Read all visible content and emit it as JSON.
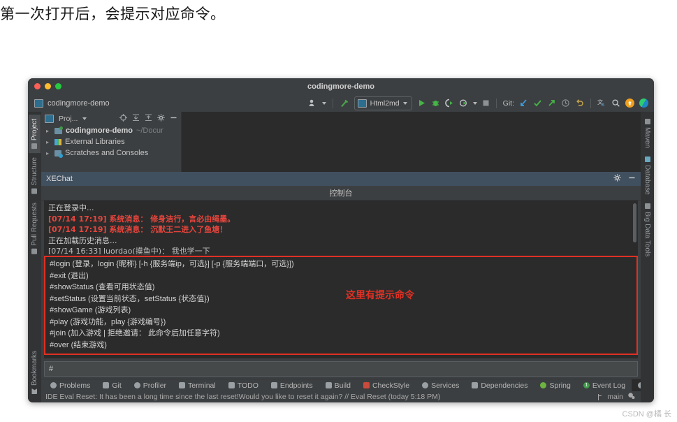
{
  "page": {
    "heading": "第一次打开后，会提示对应命令。",
    "watermark": "CSDN @橘 长"
  },
  "window": {
    "title": "codingmore-demo",
    "project_chip": "codingmore-demo"
  },
  "toolbar": {
    "run_config": "Html2md",
    "git_label": "Git:",
    "icons": [
      "profile-icon",
      "hammer-icon",
      "run-icon",
      "debug-icon",
      "coverage-icon",
      "profiler-run-icon",
      "stop-icon",
      "git-update-icon",
      "git-commit-icon",
      "git-push-icon",
      "history-icon",
      "rollback-icon",
      "translate-icon",
      "search-icon",
      "update-badge-icon",
      "plugin-logo-icon"
    ]
  },
  "left_strip": {
    "items": [
      {
        "label": "Project",
        "active": true
      },
      {
        "label": "Structure",
        "active": false
      },
      {
        "label": "Pull Requests",
        "active": false
      },
      {
        "label": "Bookmarks",
        "active": false
      }
    ]
  },
  "right_strip": {
    "items": [
      {
        "label": "Maven"
      },
      {
        "label": "Database"
      },
      {
        "label": "Big Data Tools"
      }
    ]
  },
  "project_panel": {
    "title": "Proj...",
    "tree": [
      {
        "label": "codingmore-demo",
        "suffix": "~/Docur",
        "bold": true,
        "icon": "module-folder-icon"
      },
      {
        "label": "External Libraries",
        "suffix": "",
        "bold": false,
        "icon": "libraries-icon"
      },
      {
        "label": "Scratches and Consoles",
        "suffix": "",
        "bold": false,
        "icon": "scratches-icon"
      }
    ]
  },
  "xechat": {
    "tab_label": "XEChat",
    "console_title": "控制台",
    "log": [
      {
        "text": "正在登录中...",
        "type": "normal"
      },
      {
        "text": "[07/14 17:19] 系统消息： 修身洁行，言必由绳墨。",
        "type": "system"
      },
      {
        "text": "[07/14 17:19] 系统消息： 沉默王二进入了鱼塘！",
        "type": "system"
      },
      {
        "text": "正在加载历史消息...",
        "type": "normal"
      },
      {
        "text": "[07/14 16:33] luordao(摸鱼中)： 我也学一下",
        "type": "clipped"
      }
    ],
    "commands": [
      "#login (登录，login {昵称} [-h {服务端ip，可选}] [-p {服务端端口，可选}])",
      "#exit (退出)",
      "#showStatus (查看可用状态值)",
      "#setStatus (设置当前状态，setStatus {状态值})",
      "#showGame (游戏列表)",
      "#play (游戏功能，play {游戏编号})",
      "#join (加入游戏 | 拒绝邀请： 此命令后加任意字符)",
      "#over (结束游戏)"
    ],
    "annotation": "这里有提示命令",
    "input_value": "#",
    "highlight_color": "#e03024"
  },
  "tool_windows": [
    {
      "label": "Problems",
      "icon": "problems-icon",
      "active": false,
      "badge": ""
    },
    {
      "label": "Git",
      "icon": "git-icon",
      "active": false,
      "badge": ""
    },
    {
      "label": "Profiler",
      "icon": "profiler-icon",
      "active": false,
      "badge": ""
    },
    {
      "label": "Terminal",
      "icon": "terminal-icon",
      "active": false,
      "badge": ""
    },
    {
      "label": "TODO",
      "icon": "todo-icon",
      "active": false,
      "badge": ""
    },
    {
      "label": "Endpoints",
      "icon": "endpoints-icon",
      "active": false,
      "badge": ""
    },
    {
      "label": "Build",
      "icon": "build-icon",
      "active": false,
      "badge": ""
    },
    {
      "label": "CheckStyle",
      "icon": "checkstyle-icon",
      "active": false,
      "badge": ""
    },
    {
      "label": "Services",
      "icon": "services-icon",
      "active": false,
      "badge": ""
    },
    {
      "label": "Dependencies",
      "icon": "dependencies-icon",
      "active": false,
      "badge": ""
    },
    {
      "label": "Spring",
      "icon": "spring-icon",
      "active": false,
      "badge": ""
    },
    {
      "label": "Event Log",
      "icon": "event-log-icon",
      "active": false,
      "badge": "1"
    },
    {
      "label": "XEChat",
      "icon": "xechat-icon",
      "active": true,
      "badge": ""
    }
  ],
  "statusbar": {
    "message": "IDE Eval Reset: It has been a long time since the last reset!Would you like to reset it again? // Eval Reset (today 5:18 PM)",
    "branch": "main"
  }
}
